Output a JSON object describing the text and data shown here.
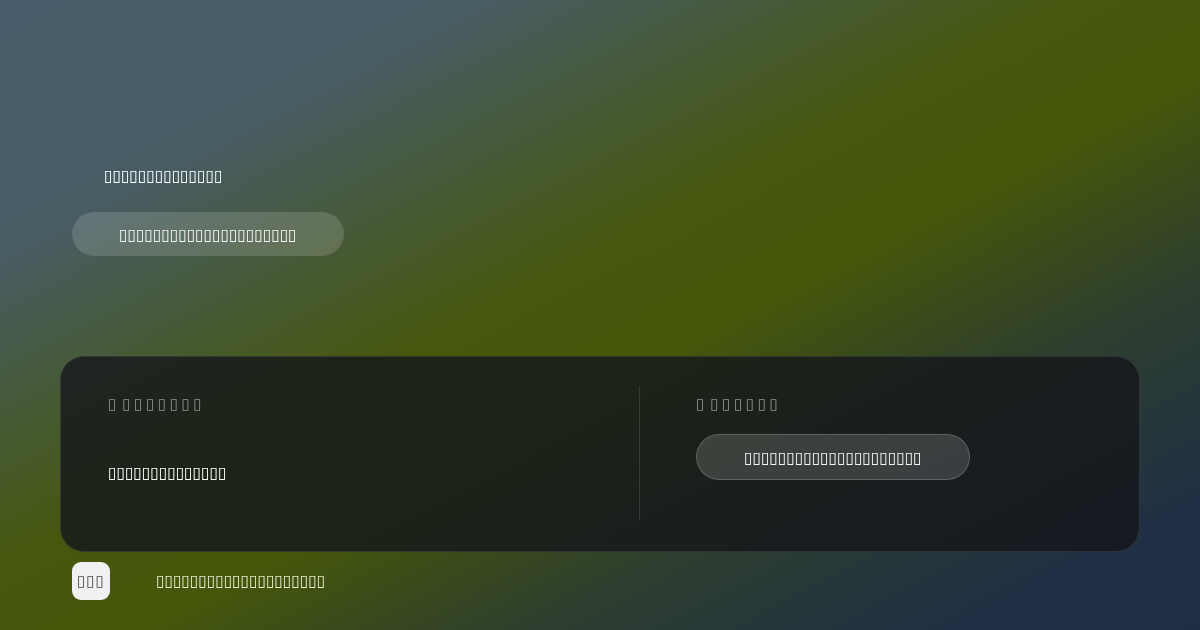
{
  "hero": {
    "title": "▯▯▯▯▯▯▯▯▯▯▯▯▯▯",
    "button": "▯▯▯▯▯▯▯▯▯▯▯▯▯▯▯▯▯▯▯▯▯"
  },
  "panel": {
    "sections": [
      {
        "kind": "text",
        "label": "▯ ▯▯▯▯▯▯▯",
        "value": "▯▯▯▯▯▯▯▯▯▯▯▯▯▯"
      },
      {
        "kind": "button",
        "label": "▯ ▯▯▯▯▯▯",
        "value": "▯▯▯▯▯▯▯▯▯▯▯▯▯▯▯▯▯▯▯▯▯"
      }
    ]
  },
  "footer": {
    "badge": "▯▯▯",
    "text": "▯▯▯▯▯▯▯▯▯▯▯▯▯▯▯▯▯▯▯▯"
  }
}
